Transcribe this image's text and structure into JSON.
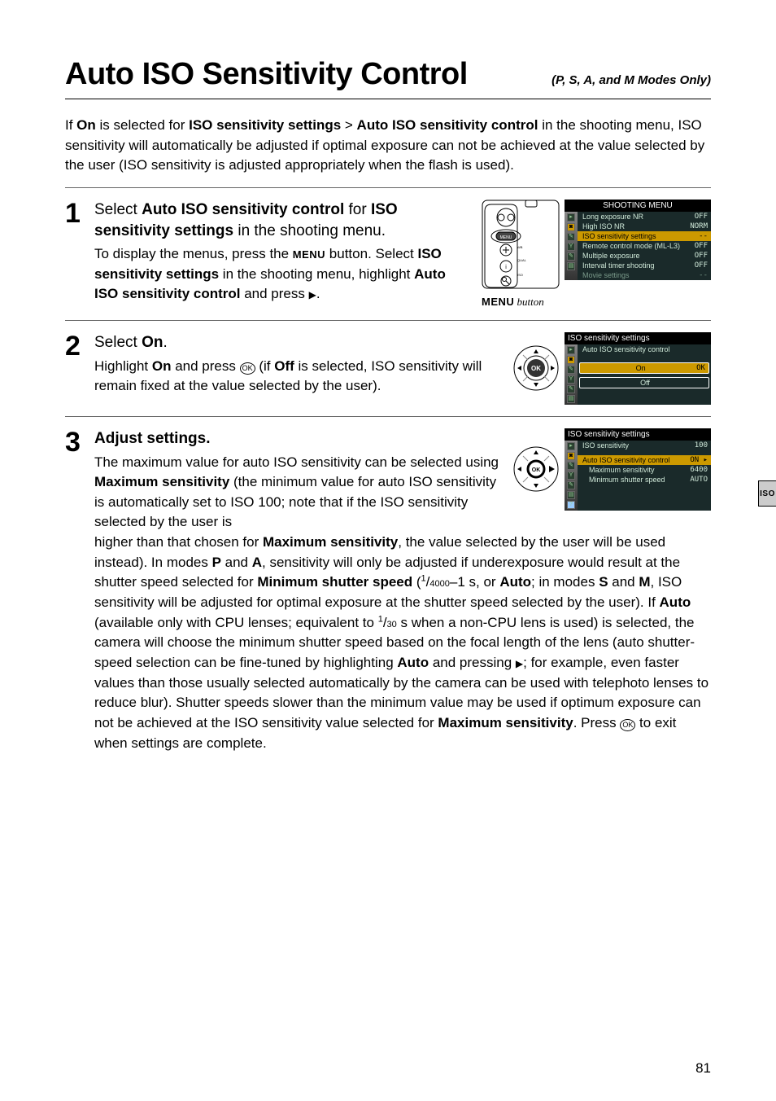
{
  "header": {
    "title": "Auto ISO Sensitivity Control",
    "subtitle": "(P, S, A, and M Modes Only)"
  },
  "intro": {
    "before_bold1": "If ",
    "bold1": "On",
    "mid1": " is selected for ",
    "bold2": "ISO sensitivity settings",
    "mid2": " > ",
    "bold3": "Auto ISO sensitivity control",
    "after": " in the shooting menu, ISO sensitivity will automatically be adjusted if optimal exposure can not be achieved at the value selected by the user (ISO sensitivity is adjusted appropriately when the flash is used)."
  },
  "steps": {
    "s1": {
      "num": "1",
      "h_lead": "Select ",
      "h_b1": "Auto ISO sensitivity control",
      "h_mid": " for ",
      "h_b2": "ISO sensitivity settings",
      "h_tail": " in the shooting menu.",
      "p_a": "To display the menus, press the ",
      "p_menu": "MENU",
      "p_b": " button. Select ",
      "p_b1": "ISO sensitivity settings",
      "p_c": " in the shooting menu, highlight ",
      "p_b2": "Auto ISO sensitivity control",
      "p_d": " and press ",
      "p_tri": "▶",
      "p_e": ".",
      "caption_a": "MENU",
      "caption_b": " button",
      "scr_hdr": "SHOOTING MENU",
      "scr_r1": "Long exposure NR",
      "scr_v1": "OFF",
      "scr_r2": "High ISO NR",
      "scr_v2": "NORM",
      "scr_r3": "ISO sensitivity settings",
      "scr_v3": "--",
      "scr_r4": "Remote control mode (ML-L3)",
      "scr_v4": "OFF",
      "scr_r5": "Multiple exposure",
      "scr_v5": "OFF",
      "scr_r6": "Interval timer shooting",
      "scr_v6": "OFF",
      "scr_r7": "Movie settings",
      "scr_v7": "--"
    },
    "s2": {
      "num": "2",
      "h_lead": "Select ",
      "h_b1": "On",
      "h_tail": ".",
      "p_a": "Highlight ",
      "p_b1": "On",
      "p_b": " and press ",
      "p_c": " (if ",
      "p_b2": "Off",
      "p_d": " is selected, ISO sensitivity will remain fixed at the value selected by the user).",
      "scr_title": "ISO sensitivity settings",
      "scr_sub": "Auto ISO sensitivity control",
      "opt_on": "On",
      "opt_off": "Off",
      "ok_mark": "OK"
    },
    "s3": {
      "num": "3",
      "h": "Adjust settings.",
      "p1_a": "The maximum value for auto ISO sensitivity can be selected using ",
      "p1_b1": "Maximum sensitivity",
      "p1_b": " (the minimum value for auto ISO sensitivity is automatically set to ISO 100; note that if the ISO sensitivity selected by the user is",
      "scr_title": "ISO sensitivity settings",
      "scr_r1": "ISO sensitivity",
      "scr_v1": "100",
      "scr_r2": "Auto ISO sensitivity control",
      "scr_v2": "ON ▸",
      "scr_r3": "Maximum sensitivity",
      "scr_v3": "6400",
      "scr_r4": "Minimum shutter speed",
      "scr_v4": "AUTO",
      "long_a": "higher than that chosen for ",
      "long_b1": "Maximum sensitivity",
      "long_b": ", the value selected by the user will be used instead).  In modes ",
      "long_P": "P",
      "long_c": " and ",
      "long_A": "A",
      "long_d": ", sensitivity will only be adjusted if underexposure would result at the shutter speed selected for ",
      "long_b2": "Minimum shutter speed",
      "long_e": " (",
      "long_f1n": "1",
      "long_f1d": "4000",
      "long_f": "–1 s, or ",
      "long_b3": "Auto",
      "long_g": "; in modes ",
      "long_S": "S",
      "long_h": " and ",
      "long_M": "M",
      "long_i": ", ISO sensitivity will be adjusted for optimal exposure at the shutter speed selected by the user).  If ",
      "long_b4": "Auto",
      "long_j": " (available only with CPU lenses; equivalent to ",
      "long_f2n": "1",
      "long_f2d": "30",
      "long_k": " s when a non-CPU lens is used) is selected, the camera will choose the minimum shutter speed based on the focal length of the lens (auto shutter-speed selection can be fine-tuned by highlighting ",
      "long_b5": "Auto",
      "long_l": " and pressing ",
      "long_tri": "▶",
      "long_m": "; for example, even faster values than those usually selected automatically by the camera can be used with telephoto lenses to reduce blur).  Shutter speeds slower than the minimum value may be used if optimum exposure can not be achieved at the ISO sensitivity value selected for ",
      "long_b6": "Maximum sensitivity",
      "long_n": ".  Press ",
      "long_o": " to exit when settings are complete."
    }
  },
  "tab": "ISO",
  "pagenum": "81"
}
